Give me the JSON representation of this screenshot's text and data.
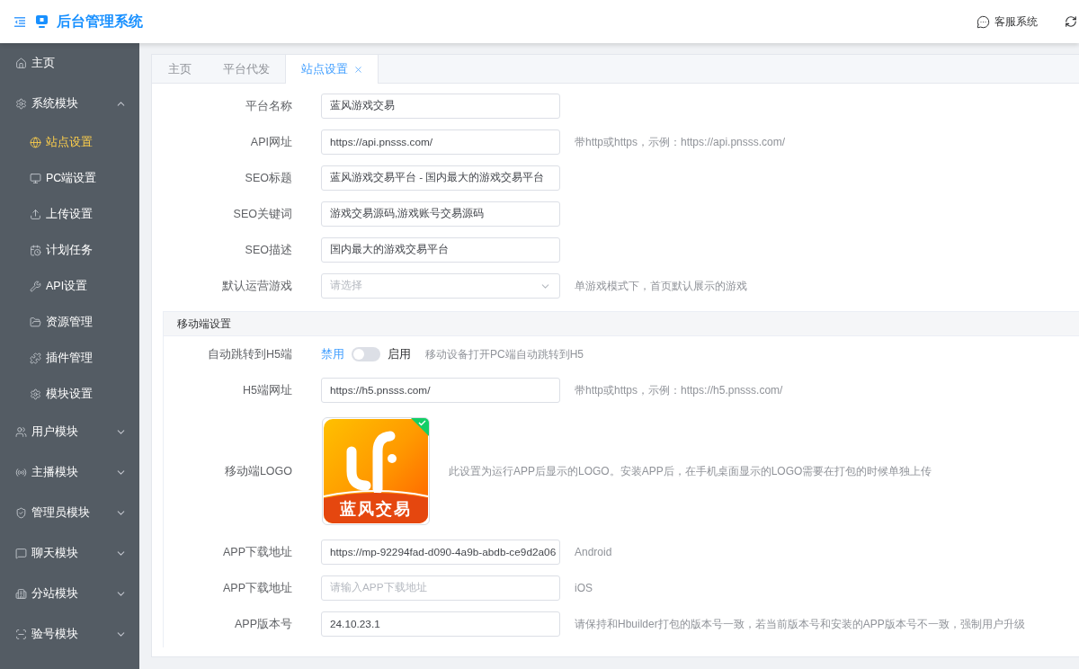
{
  "header": {
    "title": "后台管理系统",
    "service_label": "客服系统"
  },
  "sidebar": {
    "items": [
      {
        "kind": "link",
        "label": "主页",
        "selected": false
      },
      {
        "kind": "group",
        "label": "系统模块",
        "selected": false,
        "expanded": true,
        "children": [
          {
            "label": "站点设置",
            "selected": true
          },
          {
            "label": "PC端设置",
            "selected": false
          },
          {
            "label": "上传设置",
            "selected": false
          },
          {
            "label": "计划任务",
            "selected": false
          },
          {
            "label": "API设置",
            "selected": false
          },
          {
            "label": "资源管理",
            "selected": false
          },
          {
            "label": "插件管理",
            "selected": false
          },
          {
            "label": "模块设置",
            "selected": false
          }
        ]
      },
      {
        "kind": "group",
        "label": "用户模块",
        "selected": false,
        "expanded": false
      },
      {
        "kind": "group",
        "label": "主播模块",
        "selected": false,
        "expanded": false
      },
      {
        "kind": "group",
        "label": "管理员模块",
        "selected": false,
        "expanded": false
      },
      {
        "kind": "group",
        "label": "聊天模块",
        "selected": false,
        "expanded": false
      },
      {
        "kind": "group",
        "label": "分站模块",
        "selected": false,
        "expanded": false
      },
      {
        "kind": "group",
        "label": "验号模块",
        "selected": false,
        "expanded": false
      }
    ]
  },
  "tabs": [
    {
      "label": "主页",
      "selected": false,
      "closable": false
    },
    {
      "label": "平台代发",
      "selected": false,
      "closable": false
    },
    {
      "label": "站点设置",
      "selected": true,
      "closable": true
    }
  ],
  "fields": [
    {
      "kind": "text",
      "label": "平台名称",
      "value": "蓝风游戏交易"
    },
    {
      "kind": "text",
      "label": "API网址",
      "value": "https://api.pnsss.com/",
      "help": "带http或https，示例：https://api.pnsss.com/"
    },
    {
      "kind": "text",
      "label": "SEO标题",
      "value": "蓝风游戏交易平台 - 国内最大的游戏交易平台"
    },
    {
      "kind": "text",
      "label": "SEO关键词",
      "value": "游戏交易源码,游戏账号交易源码"
    },
    {
      "kind": "text",
      "label": "SEO描述",
      "value": "国内最大的游戏交易平台"
    },
    {
      "kind": "select",
      "label": "默认运营游戏",
      "placeholder": "请选择",
      "help": "单游戏模式下，首页默认展示的游戏"
    }
  ],
  "mobile_section": {
    "title": "移动端设置",
    "fields": [
      {
        "kind": "switch",
        "label": "自动跳转到H5端",
        "off_label": "禁用",
        "on_label": "启用",
        "on": false,
        "help": "移动设备打开PC端自动跳转到H5"
      },
      {
        "kind": "text",
        "label": "H5端网址",
        "value": "https://h5.pnsss.com/",
        "help": "带http或https，示例：https://h5.pnsss.com/"
      },
      {
        "kind": "image",
        "label": "移动端LOGO",
        "logo_text": "蓝风交易",
        "uploaded": true,
        "help": "此设置为运行APP后显示的LOGO。安装APP后，在手机桌面显示的LOGO需要在打包的时候单独上传"
      },
      {
        "kind": "text",
        "label": "APP下载地址",
        "value": "https://mp-92294fad-d090-4a9b-abdb-ce9d2a06",
        "help": "Android"
      },
      {
        "kind": "text",
        "label": "APP下载地址",
        "placeholder": "请输入APP下载地址",
        "help": "iOS"
      },
      {
        "kind": "text",
        "label": "APP版本号",
        "value": "24.10.23.1",
        "help": "请保持和Hbuilder打包的版本号一致，若当前版本号和安装的APP版本号不一致，强制用户升级"
      }
    ]
  }
}
